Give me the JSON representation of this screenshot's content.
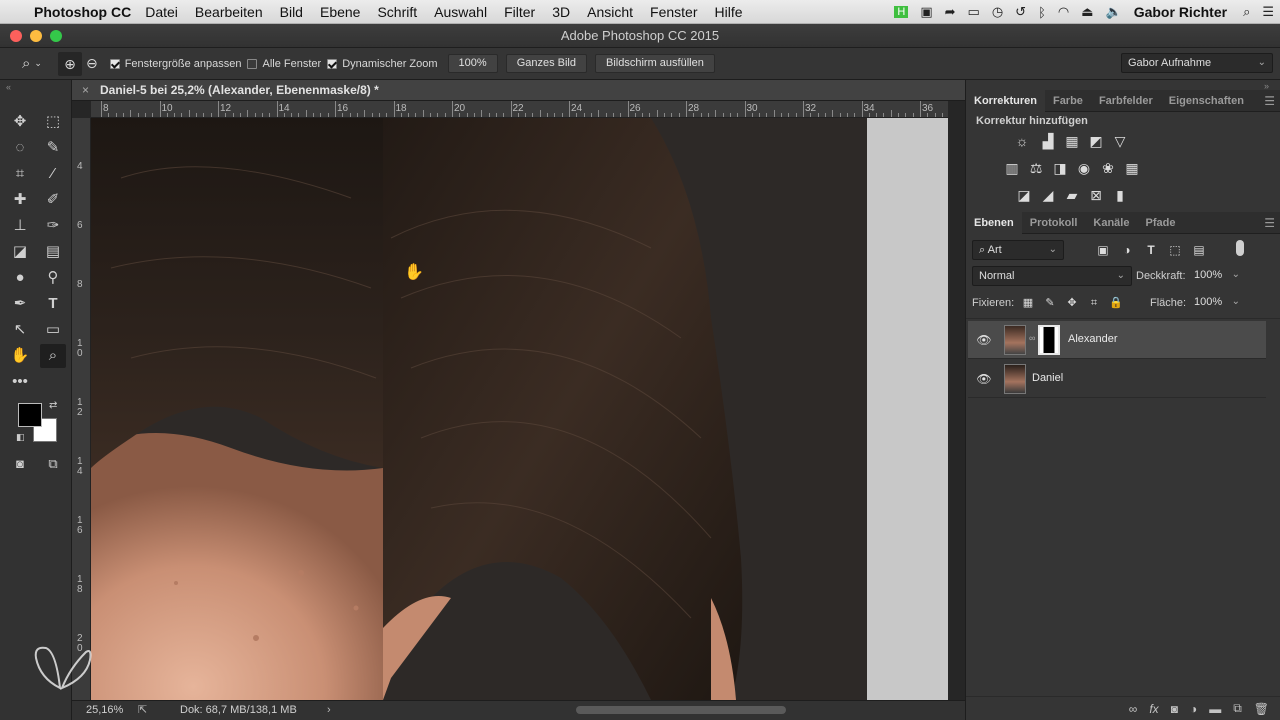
{
  "menubar": {
    "apple": "",
    "app": "Photoshop CC",
    "items": [
      "Datei",
      "Bearbeiten",
      "Bild",
      "Ebene",
      "Schrift",
      "Auswahl",
      "Filter",
      "3D",
      "Ansicht",
      "Fenster",
      "Hilfe"
    ],
    "user": "Gabor Richter"
  },
  "window": {
    "title": "Adobe Photoshop CC 2015"
  },
  "options": {
    "chk1": "Fenstergröße anpassen",
    "chk2": "Alle Fenster",
    "chk3": "Dynamischer Zoom",
    "zoom_value": "100%",
    "btn_fit": "Ganzes Bild",
    "btn_fill": "Bildschirm ausfüllen",
    "workspace": "Gabor Aufnahme"
  },
  "document": {
    "tab_title": "Daniel-5 bei 25,2% (Alexander, Ebenenmaske/8) *",
    "ruler_top": [
      "8",
      "10",
      "12",
      "14",
      "16",
      "18",
      "20",
      "22",
      "24",
      "26",
      "28",
      "30",
      "32",
      "34",
      "36"
    ],
    "ruler_left": [
      "4",
      "6",
      "8",
      "1\n0",
      "1\n2",
      "1\n4",
      "1\n6",
      "1\n8",
      "2\n0"
    ]
  },
  "status": {
    "zoom": "25,16%",
    "doc": "Dok: 68,7 MB/138,1 MB",
    "arrow": "›"
  },
  "panel_top": {
    "tabs": [
      "Korrekturen",
      "Farbe",
      "Farbfelder",
      "Eigenschaften"
    ],
    "subtitle": "Korrektur hinzufügen"
  },
  "layers_panel": {
    "tabs": [
      "Ebenen",
      "Protokoll",
      "Kanäle",
      "Pfade"
    ],
    "filter": "Art",
    "blend_mode": "Normal",
    "opacity_label": "Deckkraft:",
    "opacity_value": "100%",
    "lock_label": "Fixieren:",
    "fill_label": "Fläche:",
    "fill_value": "100%",
    "layers": [
      {
        "name": "Alexander",
        "selected": true
      },
      {
        "name": "Daniel",
        "selected": false
      }
    ]
  },
  "colors": {
    "accent": "#2d8ceb",
    "fg": "#000000",
    "bg": "#ffffff"
  }
}
